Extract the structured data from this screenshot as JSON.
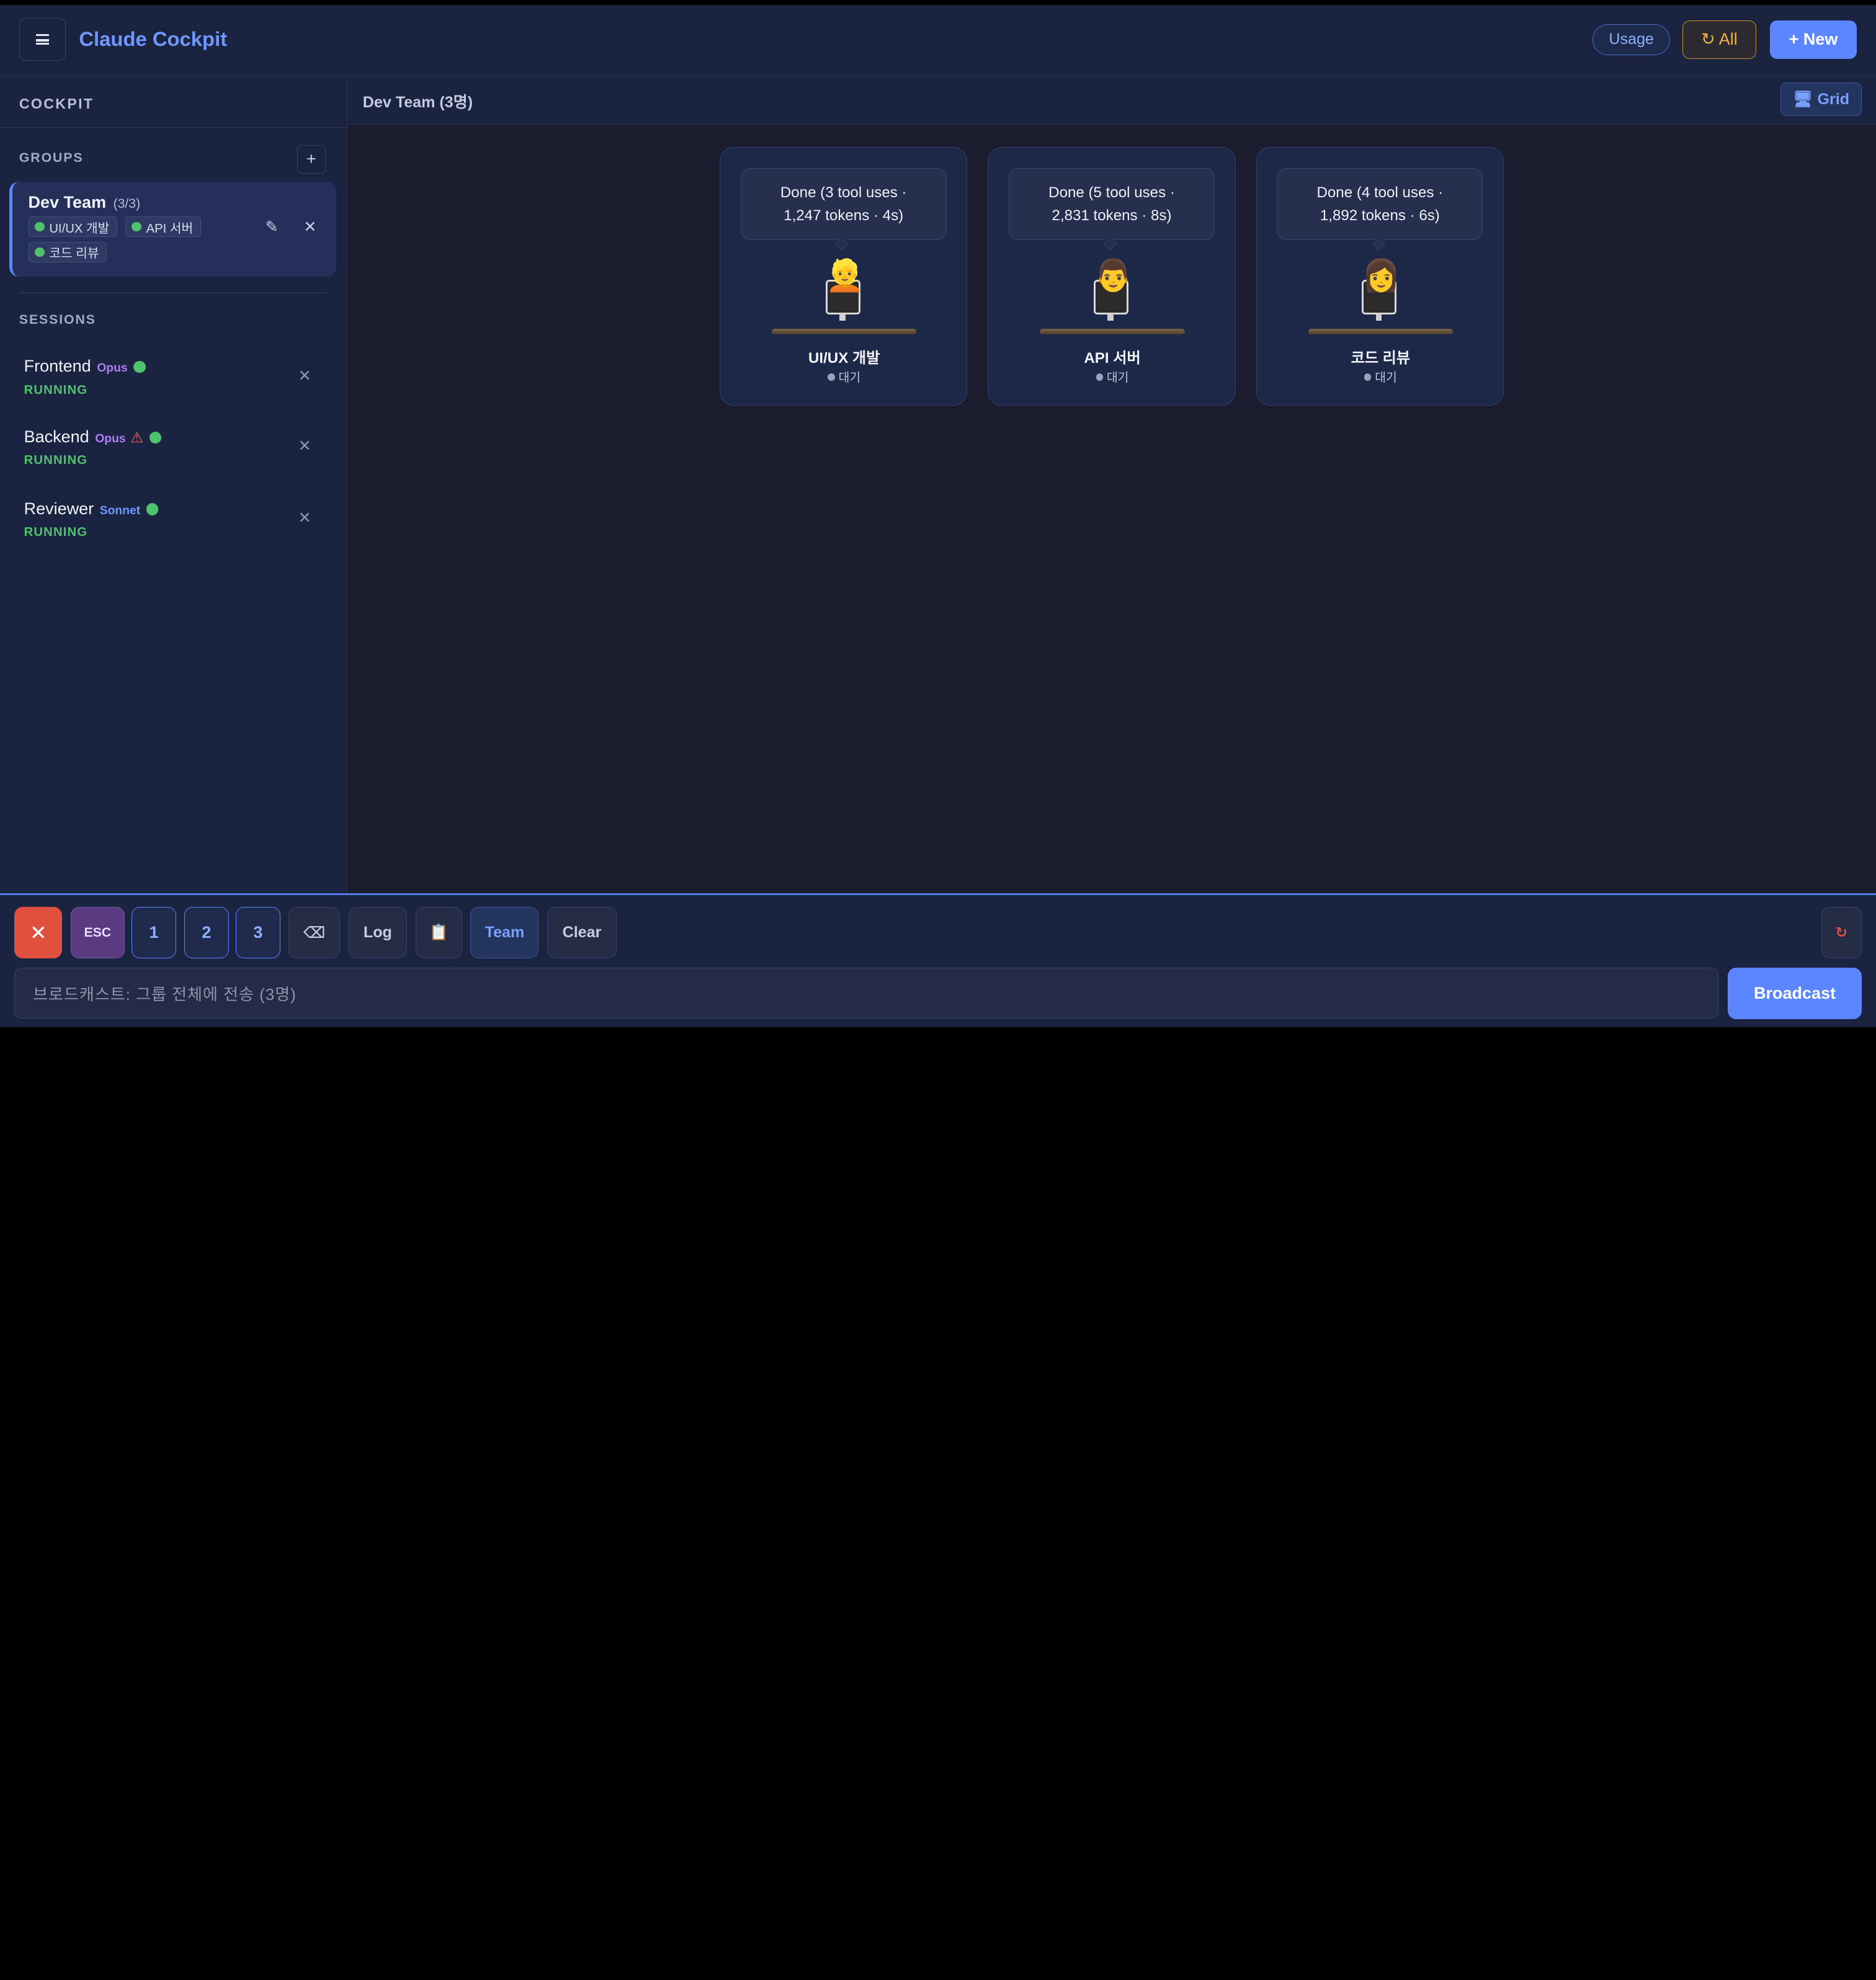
{
  "header": {
    "title": "Claude Cockpit",
    "usage_label": "Usage",
    "all_label": "↻ All",
    "new_label": "+ New"
  },
  "sidebar": {
    "heading": "COCKPIT",
    "groups_label": "GROUPS",
    "add_group_label": "+",
    "group": {
      "name": "Dev Team",
      "count": "(3/3)",
      "members": [
        "UI/UX 개발",
        "API 서버",
        "코드 리뷰"
      ]
    },
    "sessions_label": "SESSIONS",
    "sessions": [
      {
        "name": "Frontend",
        "model": "Opus",
        "model_color": "#b07cf5",
        "status": "RUNNING",
        "warning": false
      },
      {
        "name": "Backend",
        "model": "Opus",
        "model_color": "#b07cf5",
        "status": "RUNNING",
        "warning": true
      },
      {
        "name": "Reviewer",
        "model": "Sonnet",
        "model_color": "#6f98ff",
        "status": "RUNNING",
        "warning": false
      }
    ]
  },
  "main": {
    "title": "Dev Team (3명)",
    "grid_label": "Grid",
    "agents": [
      {
        "bubble_line1": "Done (3 tool uses ·",
        "bubble_line2": "1,247 tokens · 4s)",
        "name": "UI/UX 개발",
        "state": "대기",
        "avatar": "👱"
      },
      {
        "bubble_line1": "Done (5 tool uses ·",
        "bubble_line2": "2,831 tokens · 8s)",
        "name": "API 서버",
        "state": "대기",
        "avatar": "👨"
      },
      {
        "bubble_line1": "Done (4 tool uses ·",
        "bubble_line2": "1,892 tokens · 6s)",
        "name": "코드 리뷰",
        "state": "대기",
        "avatar": "👩"
      }
    ]
  },
  "controls": {
    "close_label": "✕",
    "esc_label": "ESC",
    "num_labels": [
      "1",
      "2",
      "3"
    ],
    "backspace_label": "⌫",
    "log_label": "Log",
    "clipboard_label": "📋",
    "team_label": "Team",
    "clear_label": "Clear",
    "refresh_label": "↻",
    "broadcast_placeholder": "브로드캐스트: 그룹 전체에 전송 (3명)",
    "broadcast_label": "Broadcast"
  }
}
